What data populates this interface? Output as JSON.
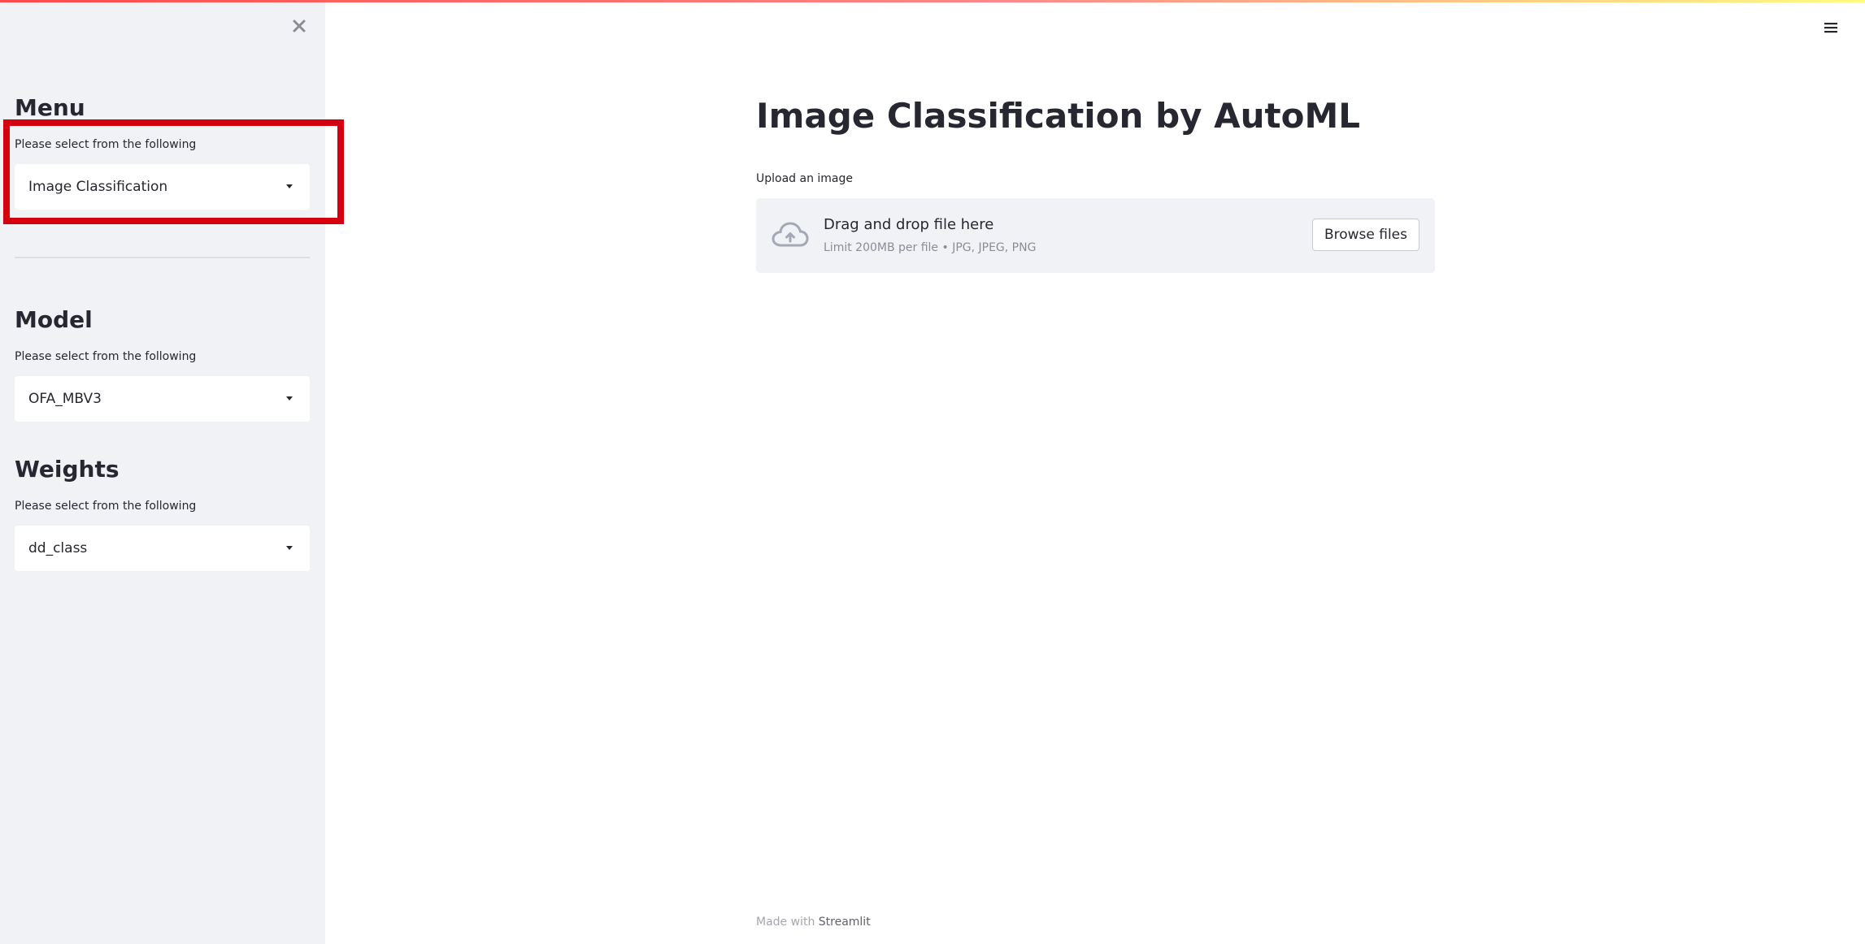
{
  "sidebar": {
    "sections": [
      {
        "heading": "Menu",
        "label": "Please select from the following",
        "selected": "Image Classification"
      },
      {
        "heading": "Model",
        "label": "Please select from the following",
        "selected": "OFA_MBV3"
      },
      {
        "heading": "Weights",
        "label": "Please select from the following",
        "selected": "dd_class"
      }
    ]
  },
  "main": {
    "title": "Image Classification by AutoML",
    "uploader": {
      "label": "Upload an image",
      "title": "Drag and drop file here",
      "limits": "Limit 200MB per file • JPG, JPEG, PNG",
      "button": "Browse files"
    }
  },
  "footer": {
    "made_with": "Made with",
    "brand": "Streamlit"
  },
  "icons": {
    "close": "close-icon",
    "menu": "hamburger-menu-icon",
    "upload": "cloud-upload-icon",
    "dropdown": "caret-down-icon"
  },
  "colors": {
    "accent": "#ff4b4b",
    "sidebar_bg": "#f0f2f6",
    "highlight": "#d40010",
    "text": "#262730"
  }
}
